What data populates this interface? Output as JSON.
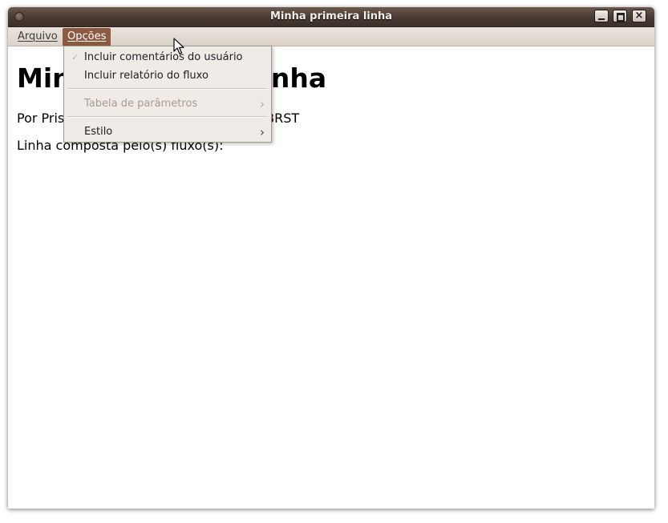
{
  "window": {
    "title": "Minha primeira linha",
    "close_glyph": "×"
  },
  "menubar": {
    "arquivo": "Arquivo",
    "opcoes": "Opções"
  },
  "document": {
    "title": "Minha primeira linha",
    "byline": "Por Priscila, Seg 31 Jan 2011 11:17:14 BRST",
    "line": "Linha composta pelo(s) fluxo(s):"
  },
  "opcoes_menu": {
    "items": [
      {
        "label": "Incluir comentários do usuário",
        "checked": true,
        "enabled": true
      },
      {
        "label": "Incluir relatório do fluxo",
        "checked": false,
        "enabled": true
      },
      {
        "label": "Tabela de parâmetros",
        "submenu": true,
        "enabled": false
      },
      {
        "label": "Estilo",
        "submenu": true,
        "enabled": true
      }
    ],
    "check_glyph": "✓",
    "submenu_glyph": "›"
  },
  "colors": {
    "titlebar": "#4a3c33",
    "menu_highlight": "#8b5a3f",
    "menubar": "#e4ddd5",
    "dropdown_bg": "#efebe7"
  }
}
